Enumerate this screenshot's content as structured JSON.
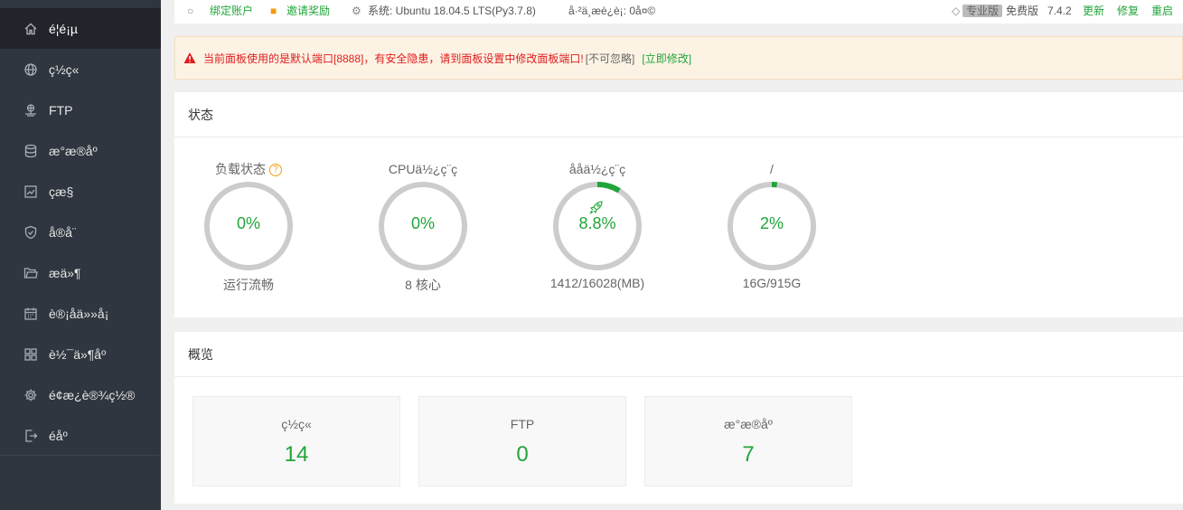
{
  "sidebar": {
    "items": [
      {
        "label": "é¦é¡µ",
        "icon": "home-icon"
      },
      {
        "label": "ç½ç«",
        "icon": "globe-icon"
      },
      {
        "label": "FTP",
        "icon": "ftp-icon"
      },
      {
        "label": "æ°æ®åº",
        "icon": "database-icon"
      },
      {
        "label": "çæ§",
        "icon": "monitor-icon"
      },
      {
        "label": "å®å¨",
        "icon": "shield-icon"
      },
      {
        "label": "æä»¶",
        "icon": "folder-icon"
      },
      {
        "label": "è®¡åä»»å¡",
        "icon": "calendar-icon"
      },
      {
        "label": "è½¯ä»¶åº",
        "icon": "apps-icon"
      },
      {
        "label": "é¢æ¿è®¾ç½®",
        "icon": "gear-icon"
      },
      {
        "label": "éåº",
        "icon": "logout-icon"
      }
    ]
  },
  "topbar": {
    "bind_account": "绑定账户",
    "invite": "邀请奖励",
    "system": "系统:  Ubuntu 18.04.5 LTS(Py3.7.8)",
    "uptime": "å·²ä¸æ­è¿è¡: 0å¤©",
    "edition_badge": "专业版",
    "free_label": "免费版",
    "version": "7.4.2",
    "update": "更新",
    "repair": "修复",
    "restart": "重启"
  },
  "alert": {
    "message": "当前面板使用的是默认端口[8888]，有安全隐患，请到面板设置中修改面板端口!",
    "ignore": "[不可忽略]",
    "fix": "[立即修改]"
  },
  "status": {
    "title": "状态",
    "gauges": [
      {
        "title": "负载状态",
        "value": "0%",
        "percent": 0,
        "sub": "运行流畅",
        "help": "?"
      },
      {
        "title": "CPUä½¿ç¨ç",
        "value": "0%",
        "percent": 0,
        "sub": "8 核心"
      },
      {
        "title": "åå­ä½¿ç¨ç",
        "value": "8.8%",
        "percent": 8.8,
        "sub": "1412/16028(MB)"
      },
      {
        "title": "/",
        "value": "2%",
        "percent": 2,
        "sub": "16G/915G"
      }
    ]
  },
  "overview": {
    "title": "概览",
    "cards": [
      {
        "label": "ç½ç«",
        "value": "14"
      },
      {
        "label": "FTP",
        "value": "0"
      },
      {
        "label": "æ°æ®åº",
        "value": "7"
      }
    ]
  },
  "colors": {
    "accent": "#20a53a",
    "sidebar": "#30363f",
    "ring_track": "#cccccc",
    "warning": "#e01d1d"
  }
}
